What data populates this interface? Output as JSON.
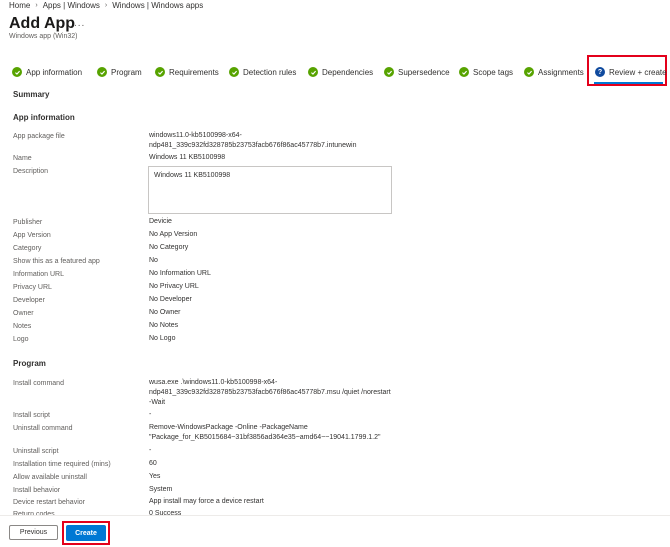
{
  "breadcrumb": [
    "Home",
    "Apps | Windows",
    "Windows | Windows apps"
  ],
  "page": {
    "title": "Add App",
    "more": "...",
    "subtitle": "Windows app (Win32)"
  },
  "tabs": [
    {
      "label": "App information",
      "status": "complete"
    },
    {
      "label": "Program",
      "status": "complete"
    },
    {
      "label": "Requirements",
      "status": "complete"
    },
    {
      "label": "Detection rules",
      "status": "complete"
    },
    {
      "label": "Dependencies",
      "status": "complete"
    },
    {
      "label": "Supersedence",
      "status": "complete"
    },
    {
      "label": "Scope tags",
      "status": "complete"
    },
    {
      "label": "Assignments",
      "status": "complete"
    },
    {
      "label": "Review + create",
      "status": "current"
    }
  ],
  "summary_label": "Summary",
  "app_information": {
    "heading": "App information",
    "rows": [
      {
        "label": "App package file",
        "value": "windows11.0-kb5100998-x64-",
        "value2": "ndp481_339c932fd328785b23753facb676f86ac45778b7.intunewin"
      },
      {
        "label": "Name",
        "value": "Windows 11 KB5100998"
      },
      {
        "label": "Description",
        "value": "Windows 11 KB5100998"
      },
      {
        "label": "Publisher",
        "value": "Devicie"
      },
      {
        "label": "App Version",
        "value": "No App Version"
      },
      {
        "label": "Category",
        "value": "No Category"
      },
      {
        "label": "Show this as a featured app",
        "value": "No"
      },
      {
        "label": "Information URL",
        "value": "No Information URL"
      },
      {
        "label": "Privacy URL",
        "value": "No Privacy URL"
      },
      {
        "label": "Developer",
        "value": "No Developer"
      },
      {
        "label": "Owner",
        "value": "No Owner"
      },
      {
        "label": "Notes",
        "value": "No Notes"
      },
      {
        "label": "Logo",
        "value": "No Logo"
      }
    ]
  },
  "program": {
    "heading": "Program",
    "rows": [
      {
        "label": "Install command",
        "value": "wusa.exe .\\windows11.0-kb5100998-x64-",
        "value2": "ndp481_339c932fd328785b23753facb676f86ac45778b7.msu /quiet /norestart",
        "value3": "-Wait"
      },
      {
        "label": "Install script",
        "value": "-"
      },
      {
        "label": "Uninstall command",
        "value": "Remove-WindowsPackage -Online -PackageName",
        "value2": "\"Package_for_KB5015684~31bf3856ad364e35~amd64~~19041.1799.1.2\""
      },
      {
        "label": "Uninstall script",
        "value": "-"
      },
      {
        "label": "Installation time required (mins)",
        "value": "60"
      },
      {
        "label": "Allow available uninstall",
        "value": "Yes"
      },
      {
        "label": "Install behavior",
        "value": "System"
      },
      {
        "label": "Device restart behavior",
        "value": "App install may force a device restart"
      },
      {
        "label": "Return codes",
        "value": "0 Success"
      }
    ]
  },
  "footer": {
    "previous_label": "Previous",
    "create_label": "Create"
  },
  "colors": {
    "accent": "#0078d4",
    "success": "#57a300",
    "highlight": "#e3001b"
  }
}
